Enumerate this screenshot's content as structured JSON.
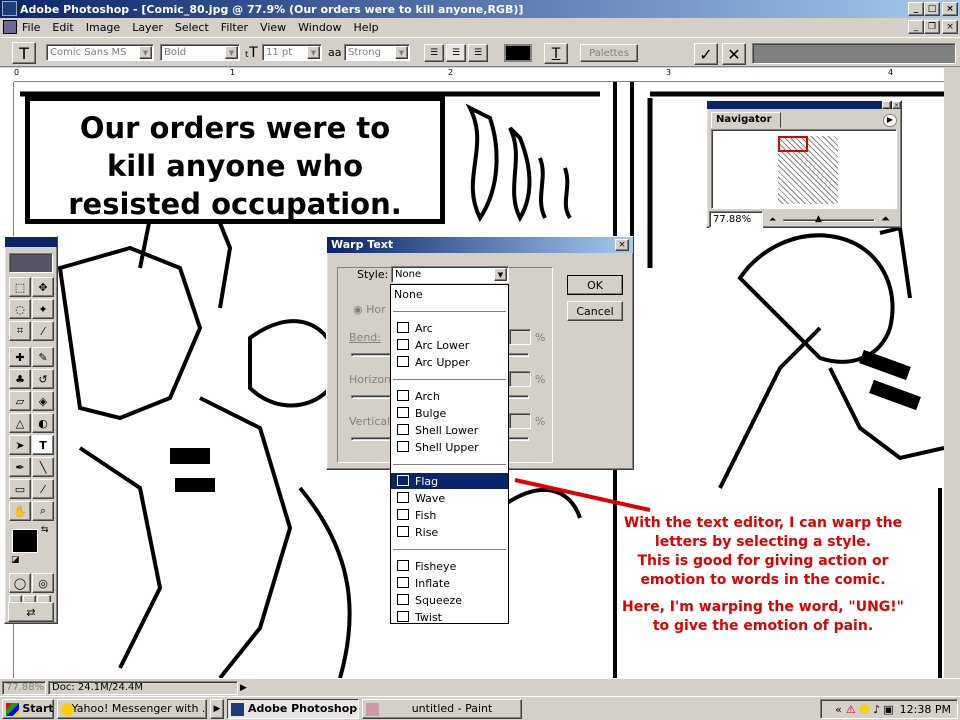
{
  "window": {
    "title": "Adobe Photoshop - [Comic_80.jpg @ 77.9% (Our orders were to kill anyone,RGB)]"
  },
  "menu": [
    "File",
    "Edit",
    "Image",
    "Layer",
    "Select",
    "Filter",
    "View",
    "Window",
    "Help"
  ],
  "options_bar": {
    "font_family": "Comic Sans MS",
    "font_style": "Bold",
    "font_size": "11 pt",
    "aa_label": "aa",
    "antialias": "Strong",
    "palettes_label": "Palettes",
    "text_color": "#000000"
  },
  "ruler": {
    "h_ticks": [
      "0",
      "1",
      "2",
      "3",
      "4"
    ]
  },
  "comic": {
    "caption_lines": [
      "Our orders were to",
      "kill anyone who",
      "resisted occupation."
    ]
  },
  "navigator": {
    "title": "Navigator",
    "zoom": "77.88%"
  },
  "warp_dialog": {
    "title": "Warp Text",
    "style_label": "Style:",
    "style_value": "None",
    "ok_label": "OK",
    "cancel_label": "Cancel",
    "horizontal_short": "Hor",
    "bend_label": "Bend:",
    "horizontal_label": "Horizon",
    "vertical_label": "Vertical",
    "percent": "%"
  },
  "style_dropdown": {
    "groups": [
      [
        "None"
      ],
      [
        "Arc",
        "Arc Lower",
        "Arc Upper"
      ],
      [
        "Arch",
        "Bulge",
        "Shell Lower",
        "Shell Upper"
      ],
      [
        "Flag",
        "Wave",
        "Fish",
        "Rise"
      ],
      [
        "Fisheye",
        "Inflate",
        "Squeeze",
        "Twist"
      ]
    ],
    "selected": "Flag"
  },
  "annotation": {
    "lines": [
      "With the text editor, I can warp the",
      "letters by selecting a style.",
      "This is good for giving action or",
      "emotion to words in the comic."
    ],
    "lines2": [
      "Here, I'm warping the word, \"UNG!\"",
      "to give the emotion of pain."
    ],
    "color": "#e00000"
  },
  "status": {
    "zoom": "77.88%",
    "doc": "Doc: 24.1M/24.4M"
  },
  "taskbar": {
    "start": "Start",
    "tasks": [
      "Yahoo! Messenger with ...",
      "Adobe Photoshop - [C...",
      "untitled - Paint"
    ],
    "clock": "12:38 PM",
    "chevron": "«"
  }
}
